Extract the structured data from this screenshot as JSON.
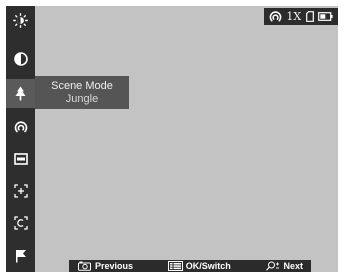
{
  "menu": {
    "items": [
      {
        "name": "brightness",
        "icon": "brightness-icon"
      },
      {
        "name": "contrast",
        "icon": "contrast-icon"
      },
      {
        "name": "scene-mode",
        "icon": "tree-icon",
        "selected": true
      },
      {
        "name": "wifi-hotspot",
        "icon": "hotspot-icon"
      },
      {
        "name": "display",
        "icon": "display-icon"
      },
      {
        "name": "reticle-zero",
        "icon": "reticle-icon"
      },
      {
        "name": "calibration",
        "icon": "calibration-icon"
      },
      {
        "name": "flag-marker",
        "icon": "flag-icon"
      }
    ]
  },
  "popup": {
    "title": "Scene Mode",
    "value": "Jungle"
  },
  "status": {
    "zoom": "1X",
    "icons": [
      "hotspot-icon",
      "sd-card-icon",
      "battery-icon"
    ]
  },
  "hints": {
    "previous": "Previous",
    "ok": "OK/Switch",
    "next": "Next"
  },
  "colors": {
    "sidebar": "#2e2e2e",
    "selected": "#5a5a5a",
    "viewfinder": "#c3c3c3",
    "popup": "#555555",
    "bar": "#2b2b2b"
  }
}
